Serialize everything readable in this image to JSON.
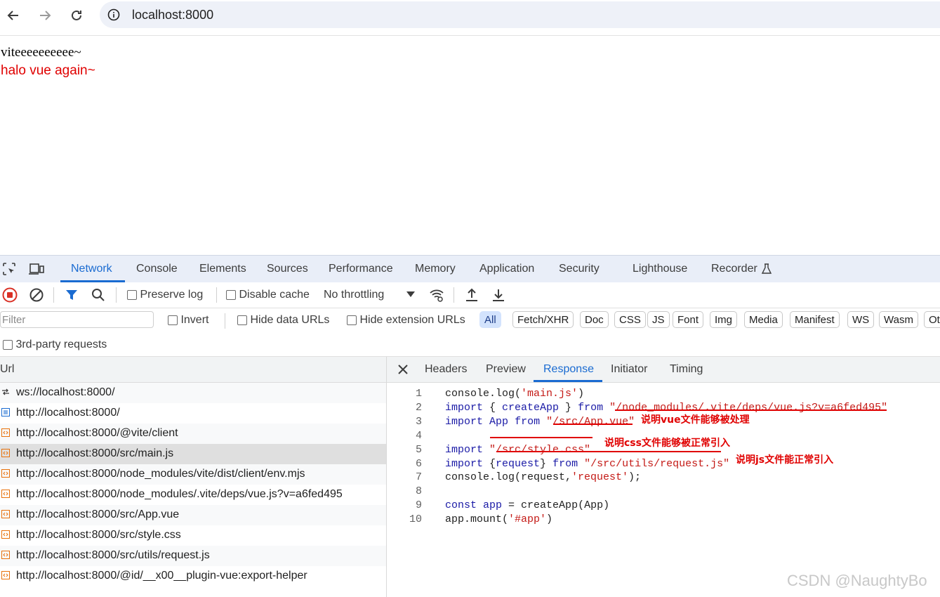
{
  "browser": {
    "url": "localhost:8000",
    "icons": {
      "back": "arrow-left-icon",
      "forward": "arrow-right-icon",
      "reload": "reload-icon",
      "info": "info-icon"
    }
  },
  "page": {
    "line1": "viteeeeeeeeee~",
    "line2": "halo vue again~",
    "line2_color": "#e00000"
  },
  "devtools": {
    "tabs": [
      "Network",
      "Console",
      "Elements",
      "Sources",
      "Performance",
      "Memory",
      "Application",
      "Security",
      "Lighthouse",
      "Recorder"
    ],
    "active_tab": "Network",
    "toolbar": {
      "preserve_log": "Preserve log",
      "disable_cache": "Disable cache",
      "throttling": "No throttling"
    },
    "filter": {
      "placeholder": "Filter",
      "invert": "Invert",
      "hide_data_urls": "Hide data URLs",
      "hide_extension_urls": "Hide extension URLs",
      "chips": [
        "All",
        "Fetch/XHR",
        "Doc",
        "CSS",
        "JS",
        "Font",
        "Img",
        "Media",
        "Manifest",
        "WS",
        "Wasm",
        "Ot"
      ],
      "third_party": "3rd-party requests"
    },
    "list": {
      "header": "Url",
      "rows": [
        {
          "url": "ws://localhost:8000/",
          "type": "ws"
        },
        {
          "url": "http://localhost:8000/",
          "type": "doc"
        },
        {
          "url": "http://localhost:8000/@vite/client",
          "type": "script"
        },
        {
          "url": "http://localhost:8000/src/main.js",
          "type": "script",
          "selected": true
        },
        {
          "url": "http://localhost:8000/node_modules/vite/dist/client/env.mjs",
          "type": "script"
        },
        {
          "url": "http://localhost:8000/node_modules/.vite/deps/vue.js?v=a6fed495",
          "type": "script"
        },
        {
          "url": "http://localhost:8000/src/App.vue",
          "type": "script"
        },
        {
          "url": "http://localhost:8000/src/style.css",
          "type": "script"
        },
        {
          "url": "http://localhost:8000/src/utils/request.js",
          "type": "script"
        },
        {
          "url": "http://localhost:8000/@id/__x00__plugin-vue:export-helper",
          "type": "script"
        }
      ]
    },
    "detail": {
      "tabs": [
        "Headers",
        "Preview",
        "Response",
        "Initiator",
        "Timing"
      ],
      "active_tab": "Response",
      "code_lines": [
        {
          "n": "1",
          "parts": [
            [
              "plain",
              "console.log("
            ],
            [
              "str",
              "'main.js'"
            ],
            [
              "plain",
              ")"
            ]
          ]
        },
        {
          "n": "2",
          "parts": [
            [
              "kw",
              "import"
            ],
            [
              "plain",
              " { "
            ],
            [
              "kw",
              "createApp"
            ],
            [
              "plain",
              " } "
            ],
            [
              "kw",
              "from"
            ],
            [
              "plain",
              " "
            ],
            [
              "str",
              "\"/node_modules/.vite/deps/vue.js?v=a6fed495\""
            ]
          ]
        },
        {
          "n": "3",
          "parts": [
            [
              "kw",
              "import"
            ],
            [
              "plain",
              " "
            ],
            [
              "kw",
              "App"
            ],
            [
              "plain",
              " "
            ],
            [
              "kw",
              "from"
            ],
            [
              "plain",
              " "
            ],
            [
              "str",
              "\"/src/App.vue\""
            ]
          ]
        },
        {
          "n": "4",
          "parts": []
        },
        {
          "n": "5",
          "parts": [
            [
              "kw",
              "import"
            ],
            [
              "plain",
              " "
            ],
            [
              "str",
              "\"/src/style.css\""
            ]
          ]
        },
        {
          "n": "6",
          "parts": [
            [
              "kw",
              "import"
            ],
            [
              "plain",
              " {"
            ],
            [
              "kw",
              "request"
            ],
            [
              "plain",
              "} "
            ],
            [
              "kw",
              "from"
            ],
            [
              "plain",
              " "
            ],
            [
              "str",
              "\"/src/utils/request.js\""
            ]
          ]
        },
        {
          "n": "7",
          "parts": [
            [
              "plain",
              "console.log(request,"
            ],
            [
              "str",
              "'request'"
            ],
            [
              "plain",
              ");"
            ]
          ]
        },
        {
          "n": "8",
          "parts": []
        },
        {
          "n": "9",
          "parts": [
            [
              "kw",
              "const"
            ],
            [
              "plain",
              " "
            ],
            [
              "kw",
              "app"
            ],
            [
              "plain",
              " = createApp(App)"
            ]
          ]
        },
        {
          "n": "10",
          "parts": [
            [
              "plain",
              "app.mount("
            ],
            [
              "str",
              "'#app'"
            ],
            [
              "plain",
              ")"
            ]
          ]
        }
      ],
      "annotations": {
        "vue": "说明vue文件能够被处理",
        "css": "说明css文件能够被正常引入",
        "js": "说明js文件能正常引入"
      }
    }
  },
  "watermark": "CSDN @NaughtyBo"
}
